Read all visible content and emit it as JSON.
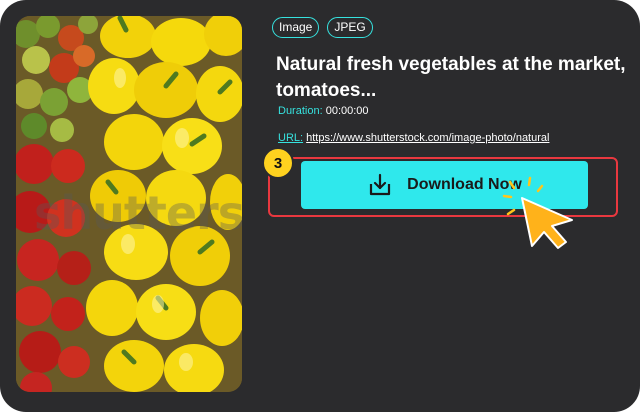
{
  "tags": [
    "Image",
    "JPEG"
  ],
  "title": "Natural fresh vegetables at the market, tomatoes...",
  "duration": {
    "label": "Duration:",
    "value": "00:00:00"
  },
  "url": {
    "label": "URL:",
    "value": "https://www.shutterstock.com/image-photo/natural"
  },
  "download_button": {
    "label": "Download Now",
    "icon": "download-icon"
  },
  "step_badge": "3",
  "watermark": "shutterstock",
  "colors": {
    "accent": "#36e2df",
    "button": "#2fe8ec",
    "highlight": "#e9383f",
    "badge": "#ffd21f",
    "background": "#2b2b2d"
  }
}
